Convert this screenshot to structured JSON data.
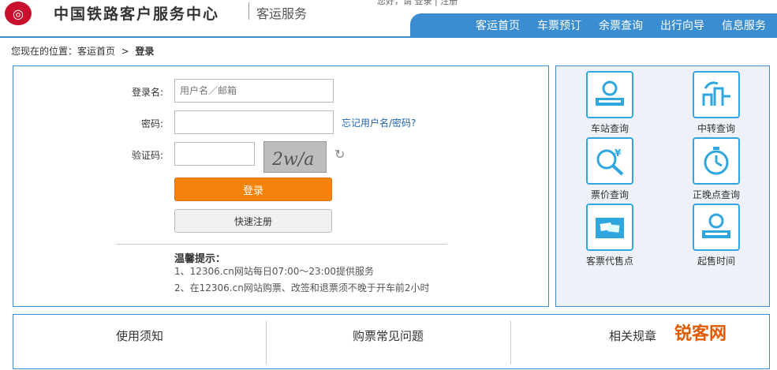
{
  "header": {
    "title": "中国铁路客户服务中心",
    "subtitle": "客运服务",
    "top_info": "您好，请 登录 | 注册"
  },
  "nav": {
    "items": [
      "客运首页",
      "车票预订",
      "余票查询",
      "出行向导",
      "信息服务"
    ]
  },
  "breadcrumb": {
    "prefix": "您现在的位置：",
    "home": "客运首页",
    "sep": ">",
    "current": "登录"
  },
  "login": {
    "username_label": "登录名:",
    "username_placeholder": "用户名／邮箱",
    "password_label": "密码:",
    "forgot_link": "忘记用户名/密码?",
    "captcha_label": "验证码:",
    "captcha_text": "2w/a",
    "login_button": "登录",
    "register_button": "快速注册",
    "tips_title": "温馨提示：",
    "tips": [
      "1、12306.cn网站每日07:00～23:00提供服务",
      "2、在12306.cn网站购票、改签和退票须不晚于开车前2小时"
    ]
  },
  "services": [
    {
      "label": "车站查询",
      "icon": "station-icon"
    },
    {
      "label": "中转查询",
      "icon": "transfer-icon"
    },
    {
      "label": "票价查询",
      "icon": "price-icon"
    },
    {
      "label": "正晚点查询",
      "icon": "clock-icon"
    },
    {
      "label": "客票代售点",
      "icon": "ticket-agency-icon"
    },
    {
      "label": "起售时间",
      "icon": "sale-time-icon"
    }
  ],
  "bottom": {
    "columns": [
      "使用须知",
      "购票常见问题",
      "相关规章"
    ]
  },
  "watermark": "锐客网"
}
